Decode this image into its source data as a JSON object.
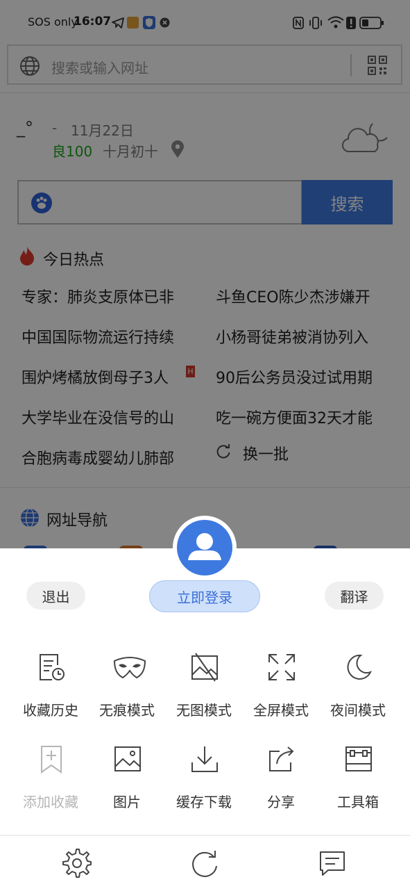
{
  "status_bar": {
    "carrier": "SOS only",
    "time": "16:07"
  },
  "address_bar": {
    "placeholder": "搜索或输入网址"
  },
  "weather": {
    "temp": "_°",
    "dash": "-",
    "date": "11月22日",
    "aqi": "良100",
    "lunar_date": "十月初十"
  },
  "search": {
    "button_label": "搜索"
  },
  "hot_topics": {
    "title": "今日热点",
    "items": [
      "专家：肺炎支原体已非",
      "斗鱼CEO陈少杰涉嫌开",
      "中国国际物流运行持续",
      "小杨哥徒弟被消协列入",
      "围炉烤橘放倒母子3人",
      "90后公务员没过试用期",
      "大学毕业在没信号的山",
      "吃一碗方便面32天才能",
      "合胞病毒成婴幼儿肺部"
    ],
    "badge": "H",
    "refresh_label": "换一批"
  },
  "nav_section": {
    "title": "网址导航"
  },
  "sheet": {
    "logout_label": "退出",
    "login_label": "立即登录",
    "translate_label": "翻译",
    "menu": [
      {
        "label": "收藏历史",
        "icon": "history-icon"
      },
      {
        "label": "无痕模式",
        "icon": "mask-icon"
      },
      {
        "label": "无图模式",
        "icon": "no-image-icon"
      },
      {
        "label": "全屏模式",
        "icon": "fullscreen-icon"
      },
      {
        "label": "夜间模式",
        "icon": "moon-icon"
      },
      {
        "label": "添加收藏",
        "icon": "bookmark-add-icon"
      },
      {
        "label": "图片",
        "icon": "image-icon"
      },
      {
        "label": "缓存下载",
        "icon": "download-icon"
      },
      {
        "label": "分享",
        "icon": "share-icon"
      },
      {
        "label": "工具箱",
        "icon": "toolbox-icon"
      }
    ]
  },
  "colors": {
    "accent": "#3e79e0",
    "aqi_green": "#1aa51a",
    "login_pill": "#cfe0fb",
    "fire_red": "#e03b2f"
  }
}
